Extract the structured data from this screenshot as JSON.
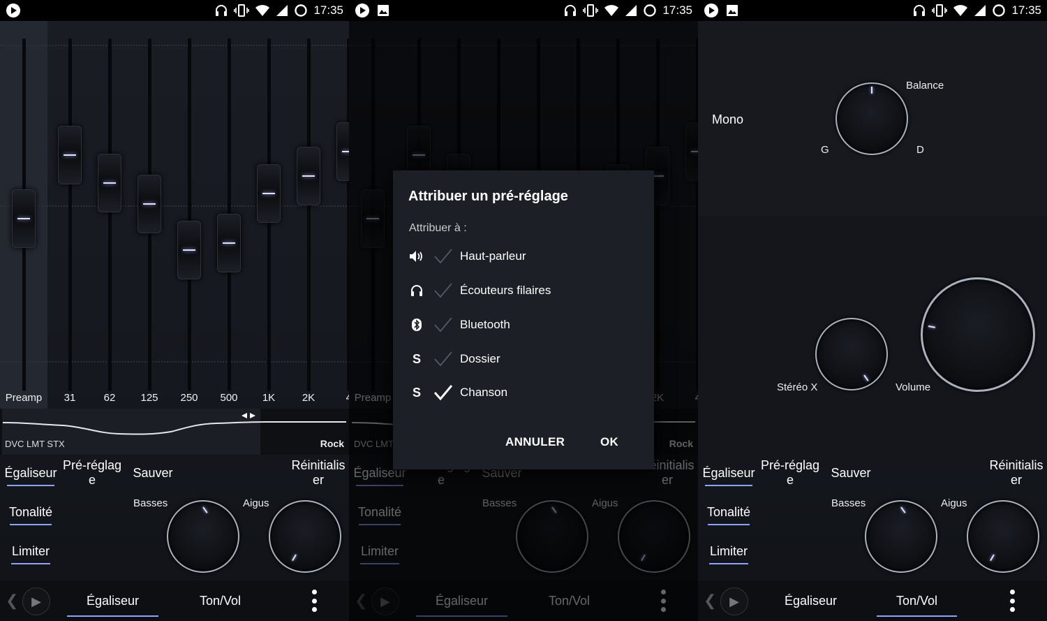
{
  "status": {
    "time": "17:35"
  },
  "eq": {
    "preamp_label": "Preamp",
    "bands": [
      {
        "label": "Preamp",
        "level": 0.49
      },
      {
        "label": "31",
        "level": 0.67
      },
      {
        "label": "62",
        "level": 0.59
      },
      {
        "label": "125",
        "level": 0.53
      },
      {
        "label": "250",
        "level": 0.4
      },
      {
        "label": "500",
        "level": 0.42
      },
      {
        "label": "1K",
        "level": 0.56
      },
      {
        "label": "2K",
        "level": 0.61
      },
      {
        "label": "4",
        "level": 0.68
      }
    ],
    "curve_subtitle": "DVC LMT STX",
    "preset_name": "Rock"
  },
  "modes": {
    "equalizer": "Égaliseur",
    "tone": "Tonalité",
    "limiter": "Limiter"
  },
  "actions": {
    "preset_line1": "Pré-réglag",
    "preset_line2": "e",
    "save": "Sauver",
    "reset_line1": "Réinitialis",
    "reset_line2": "er"
  },
  "tone": {
    "bass": "Basses",
    "treble": "Aigus"
  },
  "bottom": {
    "tab_eq": "Égaliseur",
    "tab_tonevol": "Ton/Vol"
  },
  "dialog": {
    "title": "Attribuer un pré-réglage",
    "subtitle": "Attribuer à :",
    "items": [
      {
        "label": "Haut-parleur",
        "icon": "speaker-icon",
        "checked": false
      },
      {
        "label": "Écouteurs filaires",
        "icon": "headphones-icon",
        "checked": false
      },
      {
        "label": "Bluetooth",
        "icon": "bluetooth-icon",
        "checked": false
      },
      {
        "label": "Dossier",
        "icon": "s-icon",
        "glyph": "S",
        "checked": false
      },
      {
        "label": "Chanson",
        "icon": "s-icon",
        "glyph": "S",
        "checked": true
      }
    ],
    "cancel": "ANNULER",
    "ok": "OK"
  },
  "tonevol": {
    "mono": "Mono",
    "balance": "Balance",
    "balance_left": "G",
    "balance_right": "D",
    "stereo_x": "Stéréo X",
    "volume": "Volume"
  },
  "colors": {
    "accent": "#8ea2ff",
    "background": "#15181e",
    "knob_ring": "#aab0bc"
  }
}
